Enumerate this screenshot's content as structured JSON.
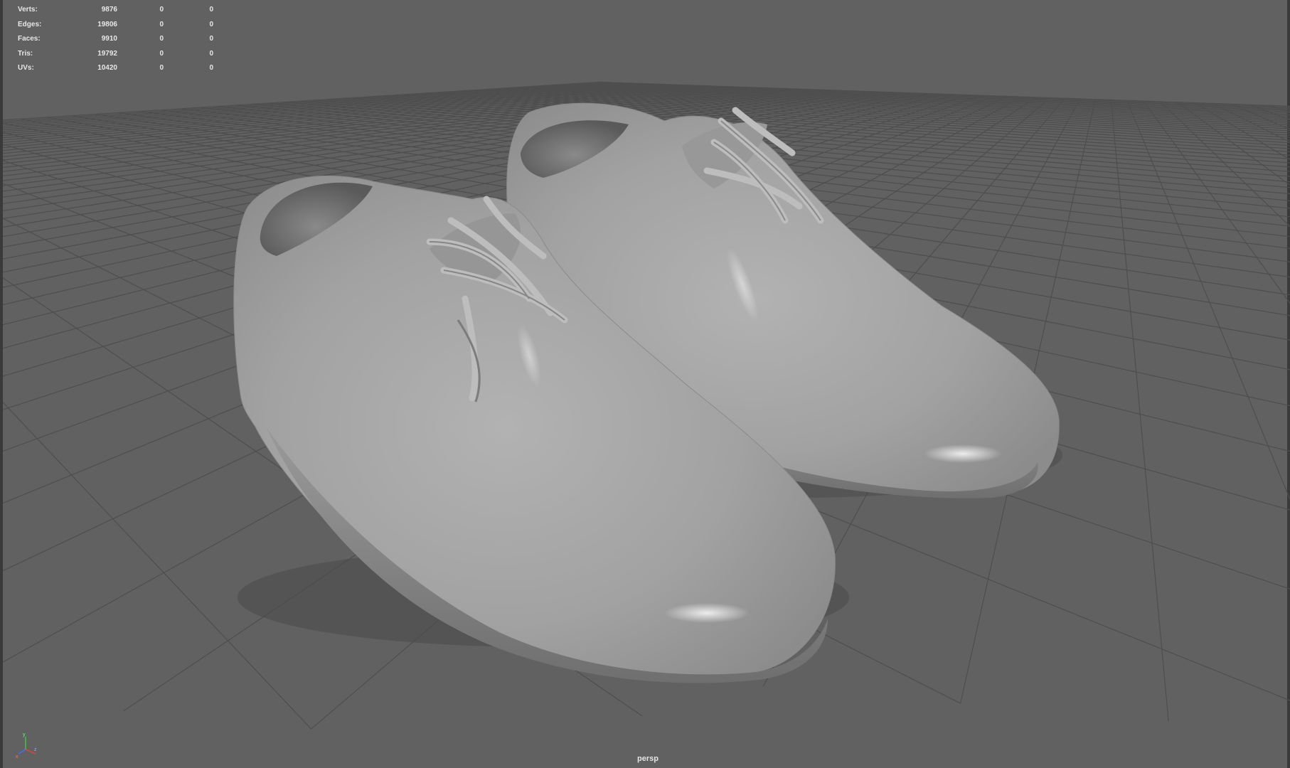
{
  "hud": {
    "rows": [
      {
        "label": "Verts:",
        "value": "9876",
        "selected": "0",
        "component": "0"
      },
      {
        "label": "Edges:",
        "value": "19806",
        "selected": "0",
        "component": "0"
      },
      {
        "label": "Faces:",
        "value": "9910",
        "selected": "0",
        "component": "0"
      },
      {
        "label": "Tris:",
        "value": "19792",
        "selected": "0",
        "component": "0"
      },
      {
        "label": "UVs:",
        "value": "10420",
        "selected": "0",
        "component": "0"
      }
    ]
  },
  "viewport": {
    "camera": "persp",
    "background_color": "#616161",
    "grid_color": "#4e4e4e",
    "model_color": "#a3a3a3"
  },
  "axis_gizmo": {
    "x_color": "#e04040",
    "y_color": "#40c040",
    "z_color": "#4070ff"
  }
}
